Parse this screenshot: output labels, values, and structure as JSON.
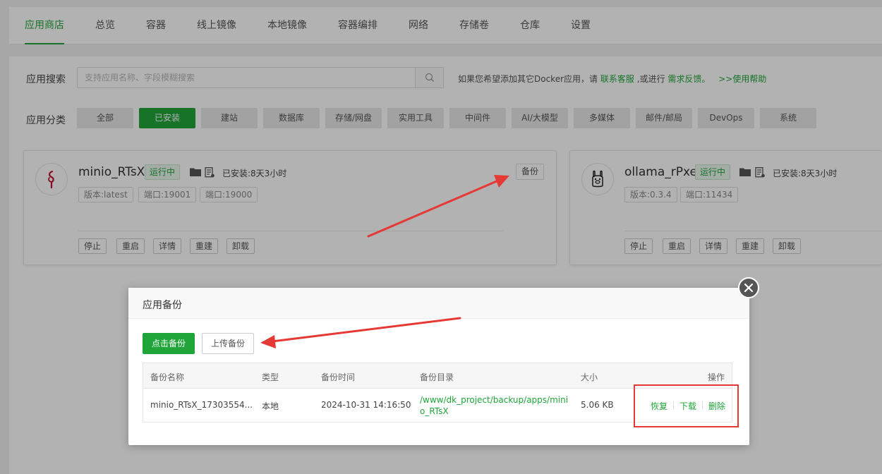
{
  "nav": {
    "tabs": [
      "应用商店",
      "总览",
      "容器",
      "线上镜像",
      "本地镜像",
      "容器编排",
      "网络",
      "存储卷",
      "仓库",
      "设置"
    ],
    "active": "应用商店"
  },
  "search": {
    "label": "应用搜索",
    "placeholder": "支持应用名称、字段模糊搜索",
    "hint_prefix": "如果您希望添加其它Docker应用，请",
    "hint_link1": "联系客服",
    "hint_mid": ",或进行",
    "hint_link2": "需求反馈。",
    "hint_link3": ">>使用帮助"
  },
  "category": {
    "label": "应用分类",
    "items": [
      "全部",
      "已安装",
      "建站",
      "数据库",
      "存储/网盘",
      "实用工具",
      "中间件",
      "AI/大模型",
      "多媒体",
      "邮件/邮局",
      "DevOps",
      "系统"
    ],
    "active": "已安装"
  },
  "apps": [
    {
      "name": "minio_RTsX",
      "status": "运行中",
      "installed": "已安装:8天3小时",
      "version": "版本:latest",
      "ports": [
        "端口:19001",
        "端口:19000"
      ],
      "backup": "备份",
      "actions": [
        "停止",
        "重启",
        "详情",
        "重建",
        "卸载"
      ]
    },
    {
      "name": "ollama_rPxe",
      "status": "运行中",
      "installed": "已安装:8天3小时",
      "version": "版本:0.3.4",
      "ports": [
        "端口:11434"
      ],
      "actions": [
        "停止",
        "重启",
        "详情",
        "重建",
        "卸载"
      ]
    }
  ],
  "modal": {
    "title": "应用备份",
    "backup_btn": "点击备份",
    "upload_btn": "上传备份",
    "columns": [
      "备份名称",
      "类型",
      "备份时间",
      "备份目录",
      "大小",
      "操作"
    ],
    "rows": [
      {
        "name": "minio_RTsX_17303554...",
        "type": "本地",
        "time": "2024-10-31 14:16:50",
        "dir_line1": "/www/dk_project/backup/apps/mini",
        "dir_line2": "o_RTsX",
        "size": "5.06 KB",
        "ops": [
          "恢复",
          "下载",
          "删除"
        ]
      }
    ]
  },
  "colors": {
    "accent": "#20a53a",
    "annotation": "#e53935"
  }
}
